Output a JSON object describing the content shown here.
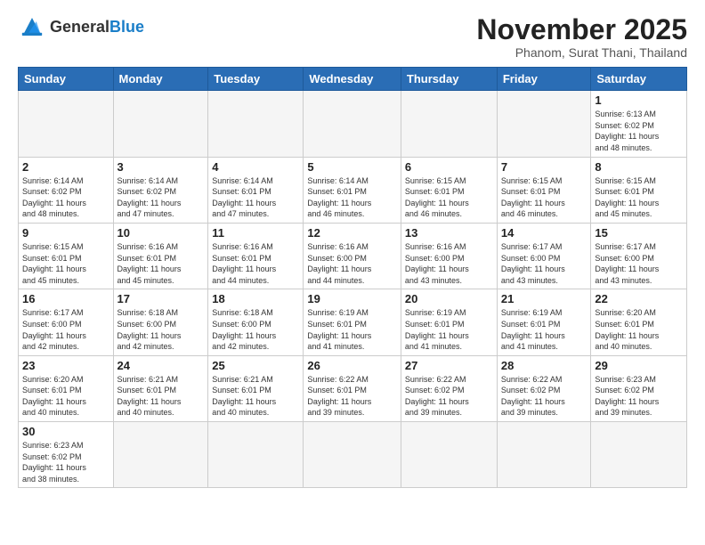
{
  "logo": {
    "text_general": "General",
    "text_blue": "Blue"
  },
  "header": {
    "month_title": "November 2025",
    "subtitle": "Phanom, Surat Thani, Thailand"
  },
  "weekdays": [
    "Sunday",
    "Monday",
    "Tuesday",
    "Wednesday",
    "Thursday",
    "Friday",
    "Saturday"
  ],
  "weeks": [
    {
      "days": [
        {
          "num": "",
          "info": ""
        },
        {
          "num": "",
          "info": ""
        },
        {
          "num": "",
          "info": ""
        },
        {
          "num": "",
          "info": ""
        },
        {
          "num": "",
          "info": ""
        },
        {
          "num": "",
          "info": ""
        },
        {
          "num": "1",
          "info": "Sunrise: 6:13 AM\nSunset: 6:02 PM\nDaylight: 11 hours\nand 48 minutes."
        }
      ]
    },
    {
      "days": [
        {
          "num": "2",
          "info": "Sunrise: 6:14 AM\nSunset: 6:02 PM\nDaylight: 11 hours\nand 48 minutes."
        },
        {
          "num": "3",
          "info": "Sunrise: 6:14 AM\nSunset: 6:02 PM\nDaylight: 11 hours\nand 47 minutes."
        },
        {
          "num": "4",
          "info": "Sunrise: 6:14 AM\nSunset: 6:01 PM\nDaylight: 11 hours\nand 47 minutes."
        },
        {
          "num": "5",
          "info": "Sunrise: 6:14 AM\nSunset: 6:01 PM\nDaylight: 11 hours\nand 46 minutes."
        },
        {
          "num": "6",
          "info": "Sunrise: 6:15 AM\nSunset: 6:01 PM\nDaylight: 11 hours\nand 46 minutes."
        },
        {
          "num": "7",
          "info": "Sunrise: 6:15 AM\nSunset: 6:01 PM\nDaylight: 11 hours\nand 46 minutes."
        },
        {
          "num": "8",
          "info": "Sunrise: 6:15 AM\nSunset: 6:01 PM\nDaylight: 11 hours\nand 45 minutes."
        }
      ]
    },
    {
      "days": [
        {
          "num": "9",
          "info": "Sunrise: 6:15 AM\nSunset: 6:01 PM\nDaylight: 11 hours\nand 45 minutes."
        },
        {
          "num": "10",
          "info": "Sunrise: 6:16 AM\nSunset: 6:01 PM\nDaylight: 11 hours\nand 45 minutes."
        },
        {
          "num": "11",
          "info": "Sunrise: 6:16 AM\nSunset: 6:01 PM\nDaylight: 11 hours\nand 44 minutes."
        },
        {
          "num": "12",
          "info": "Sunrise: 6:16 AM\nSunset: 6:00 PM\nDaylight: 11 hours\nand 44 minutes."
        },
        {
          "num": "13",
          "info": "Sunrise: 6:16 AM\nSunset: 6:00 PM\nDaylight: 11 hours\nand 43 minutes."
        },
        {
          "num": "14",
          "info": "Sunrise: 6:17 AM\nSunset: 6:00 PM\nDaylight: 11 hours\nand 43 minutes."
        },
        {
          "num": "15",
          "info": "Sunrise: 6:17 AM\nSunset: 6:00 PM\nDaylight: 11 hours\nand 43 minutes."
        }
      ]
    },
    {
      "days": [
        {
          "num": "16",
          "info": "Sunrise: 6:17 AM\nSunset: 6:00 PM\nDaylight: 11 hours\nand 42 minutes."
        },
        {
          "num": "17",
          "info": "Sunrise: 6:18 AM\nSunset: 6:00 PM\nDaylight: 11 hours\nand 42 minutes."
        },
        {
          "num": "18",
          "info": "Sunrise: 6:18 AM\nSunset: 6:00 PM\nDaylight: 11 hours\nand 42 minutes."
        },
        {
          "num": "19",
          "info": "Sunrise: 6:19 AM\nSunset: 6:01 PM\nDaylight: 11 hours\nand 41 minutes."
        },
        {
          "num": "20",
          "info": "Sunrise: 6:19 AM\nSunset: 6:01 PM\nDaylight: 11 hours\nand 41 minutes."
        },
        {
          "num": "21",
          "info": "Sunrise: 6:19 AM\nSunset: 6:01 PM\nDaylight: 11 hours\nand 41 minutes."
        },
        {
          "num": "22",
          "info": "Sunrise: 6:20 AM\nSunset: 6:01 PM\nDaylight: 11 hours\nand 40 minutes."
        }
      ]
    },
    {
      "days": [
        {
          "num": "23",
          "info": "Sunrise: 6:20 AM\nSunset: 6:01 PM\nDaylight: 11 hours\nand 40 minutes."
        },
        {
          "num": "24",
          "info": "Sunrise: 6:21 AM\nSunset: 6:01 PM\nDaylight: 11 hours\nand 40 minutes."
        },
        {
          "num": "25",
          "info": "Sunrise: 6:21 AM\nSunset: 6:01 PM\nDaylight: 11 hours\nand 40 minutes."
        },
        {
          "num": "26",
          "info": "Sunrise: 6:22 AM\nSunset: 6:01 PM\nDaylight: 11 hours\nand 39 minutes."
        },
        {
          "num": "27",
          "info": "Sunrise: 6:22 AM\nSunset: 6:02 PM\nDaylight: 11 hours\nand 39 minutes."
        },
        {
          "num": "28",
          "info": "Sunrise: 6:22 AM\nSunset: 6:02 PM\nDaylight: 11 hours\nand 39 minutes."
        },
        {
          "num": "29",
          "info": "Sunrise: 6:23 AM\nSunset: 6:02 PM\nDaylight: 11 hours\nand 39 minutes."
        }
      ]
    },
    {
      "days": [
        {
          "num": "30",
          "info": "Sunrise: 6:23 AM\nSunset: 6:02 PM\nDaylight: 11 hours\nand 38 minutes."
        },
        {
          "num": "",
          "info": ""
        },
        {
          "num": "",
          "info": ""
        },
        {
          "num": "",
          "info": ""
        },
        {
          "num": "",
          "info": ""
        },
        {
          "num": "",
          "info": ""
        },
        {
          "num": "",
          "info": ""
        }
      ]
    }
  ]
}
